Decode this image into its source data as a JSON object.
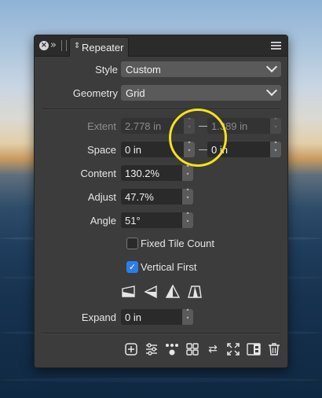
{
  "panel": {
    "tab_label": "Repeater",
    "close_glyph": "×",
    "collapse_glyph": "»",
    "tab_arrows": "⇕"
  },
  "fields": {
    "style_label": "Style",
    "style_value": "Custom",
    "geometry_label": "Geometry",
    "geometry_value": "Grid",
    "extent_label": "Extent",
    "extent_x": "2.778 in",
    "extent_y": "1.389 in",
    "space_label": "Space",
    "space_x": "0 in",
    "space_y": "0 in",
    "content_label": "Content",
    "content_value": "130.2%",
    "adjust_label": "Adjust",
    "adjust_value": "47.7%",
    "angle_label": "Angle",
    "angle_value": "51°",
    "expand_label": "Expand",
    "expand_value": "0 in"
  },
  "checkboxes": {
    "fixed_tile_count_label": "Fixed Tile Count",
    "fixed_tile_count_checked": false,
    "vertical_first_label": "Vertical First",
    "vertical_first_checked": true
  },
  "icons": {
    "spin_up": "˄",
    "spin_down": "˅",
    "check": "✓",
    "bottom_toolbar": [
      "add-icon",
      "sliders-icon",
      "nodes-icon",
      "grid-icon",
      "shuffle-icon",
      "expand-icon",
      "split-view-icon",
      "trash-icon"
    ],
    "shuffle_glyph": "⇄",
    "trash_glyph": "🗑"
  },
  "colors": {
    "accent": "#2a7fe8",
    "highlight_ring": "#f5e21a",
    "panel_bg": "#3c3c3c"
  }
}
